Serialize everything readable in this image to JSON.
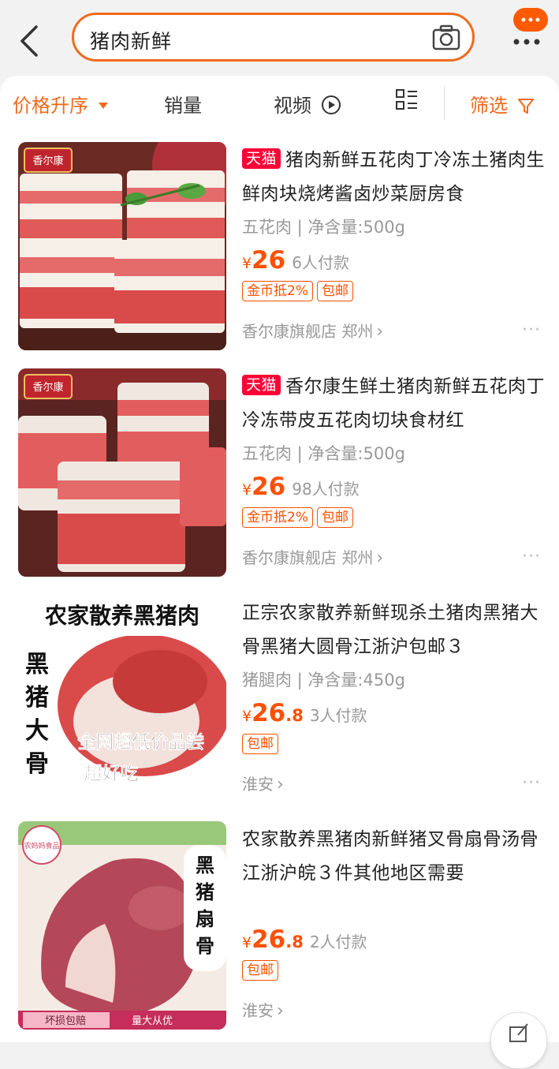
{
  "search": {
    "query": "猪肉新鲜"
  },
  "sort_bar": {
    "price_asc": "价格升序",
    "sales": "销量",
    "video": "视频",
    "filter": "筛选"
  },
  "colors": {
    "accent": "#f06a1d",
    "price": "#ff5000",
    "tmall": "#ff0036"
  },
  "items": [
    {
      "badge": "天猫",
      "title": "猪肉新鲜五花肉丁冷冻土猪肉生鲜肉块烧烤酱卤炒菜厨房食",
      "spec": "五花肉 | 净含量:500g",
      "yen": "¥",
      "price_int": "26",
      "price_dec": "",
      "paid": "6人付款",
      "tags": [
        "金币抵2%",
        "包邮"
      ],
      "shop": "香尔康旗舰店 郑州",
      "image_brand": "香尔康"
    },
    {
      "badge": "天猫",
      "title": "香尔康生鲜土猪肉新鲜五花肉丁冷冻带皮五花肉切块食材红",
      "spec": "五花肉 | 净含量:500g",
      "yen": "¥",
      "price_int": "26",
      "price_dec": "",
      "paid": "98人付款",
      "tags": [
        "金币抵2%",
        "包邮"
      ],
      "shop": "香尔康旗舰店 郑州",
      "image_brand": "香尔康"
    },
    {
      "badge": "",
      "title": "正宗农家散养新鲜现杀土猪肉黑猪大骨黑猪大圆骨江浙沪包邮３",
      "spec": "猪腿肉 | 净含量:450g",
      "yen": "¥",
      "price_int": "26",
      "price_dec": ".8",
      "paid": "3人付款",
      "tags": [
        "包邮"
      ],
      "shop": "淮安",
      "image_banner": "农家散养黑猪肉",
      "image_side": "黑猪大骨",
      "image_slogan1": "全网超低价品尝",
      "image_slogan2": "超好吃"
    },
    {
      "badge": "",
      "title": "农家散养黑猪肉新鲜猪叉骨扇骨汤骨江浙沪皖３件其他地区需要",
      "spec": "",
      "yen": "¥",
      "price_int": "26",
      "price_dec": ".8",
      "paid": "2人付款",
      "tags": [
        "包邮"
      ],
      "shop": "淮安",
      "image_logo": "农妈妈食品",
      "image_side": "黑猪扇骨",
      "image_strip1": "坏损包赔",
      "image_strip2": "量大从优"
    }
  ]
}
